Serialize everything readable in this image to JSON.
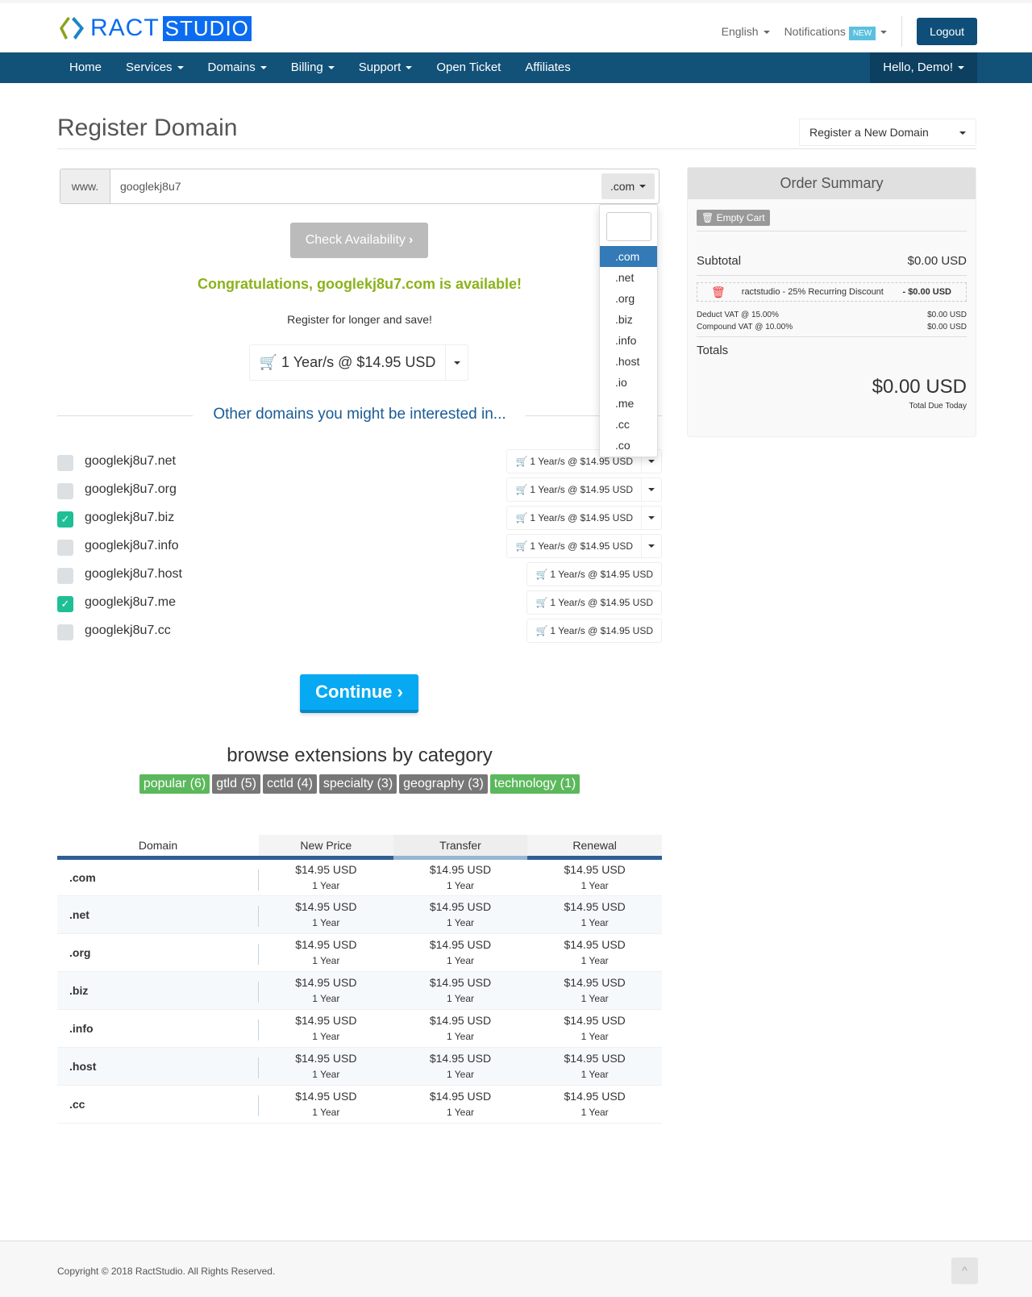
{
  "brand": {
    "logo_text_1": "RACT",
    "logo_text_2": "STUDIO"
  },
  "top": {
    "language": "English",
    "notifications": "Notifications",
    "new_badge": "NEW",
    "logout": "Logout"
  },
  "nav": {
    "items": [
      "Home",
      "Services",
      "Domains",
      "Billing",
      "Support",
      "Open Ticket",
      "Affiliates"
    ],
    "user": "Hello, Demo!"
  },
  "page": {
    "title": "Register Domain",
    "action_select": "Register a New Domain"
  },
  "search": {
    "prefix": "www.",
    "value": "googlekj8u7",
    "tld": ".com",
    "tld_options": [
      ".com",
      ".net",
      ".org",
      ".biz",
      ".info",
      ".host",
      ".io",
      ".me",
      ".cc",
      ".co"
    ],
    "check_label": "Check Availability"
  },
  "result": {
    "message": "Congratulations, googlekj8u7.com is available!",
    "longer": "Register for longer and save!",
    "price": "1 Year/s @ $14.95 USD"
  },
  "suggestions": {
    "heading": "Other domains you might be interested in...",
    "items": [
      {
        "domain": "googlekj8u7.net",
        "checked": false,
        "price": "1 Year/s @ $14.95 USD"
      },
      {
        "domain": "googlekj8u7.org",
        "checked": false,
        "price": "1 Year/s @ $14.95 USD"
      },
      {
        "domain": "googlekj8u7.biz",
        "checked": true,
        "price": "1 Year/s @ $14.95 USD"
      },
      {
        "domain": "googlekj8u7.info",
        "checked": false,
        "price": "1 Year/s @ $14.95 USD"
      },
      {
        "domain": "googlekj8u7.host",
        "checked": false,
        "price": "1 Year/s @ $14.95 USD"
      },
      {
        "domain": "googlekj8u7.me",
        "checked": true,
        "price": "1 Year/s @ $14.95 USD"
      },
      {
        "domain": "googlekj8u7.cc",
        "checked": false,
        "price": "1 Year/s @ $14.95 USD"
      }
    ]
  },
  "continue_label": "Continue",
  "browse": {
    "heading": "browse extensions by category",
    "tags": [
      "popular (6)",
      "gtld (5)",
      "cctld (4)",
      "specialty (3)",
      "geography (3)",
      "technology (1)"
    ]
  },
  "pricing": {
    "headers": [
      "Domain",
      "New Price",
      "Transfer",
      "Renewal"
    ],
    "rows": [
      {
        "tld": ".com",
        "new": "$14.95 USD",
        "transfer": "$14.95 USD",
        "renewal": "$14.95 USD",
        "period": "1 Year"
      },
      {
        "tld": ".net",
        "new": "$14.95 USD",
        "transfer": "$14.95 USD",
        "renewal": "$14.95 USD",
        "period": "1 Year"
      },
      {
        "tld": ".org",
        "new": "$14.95 USD",
        "transfer": "$14.95 USD",
        "renewal": "$14.95 USD",
        "period": "1 Year"
      },
      {
        "tld": ".biz",
        "new": "$14.95 USD",
        "transfer": "$14.95 USD",
        "renewal": "$14.95 USD",
        "period": "1 Year"
      },
      {
        "tld": ".info",
        "new": "$14.95 USD",
        "transfer": "$14.95 USD",
        "renewal": "$14.95 USD",
        "period": "1 Year"
      },
      {
        "tld": ".host",
        "new": "$14.95 USD",
        "transfer": "$14.95 USD",
        "renewal": "$14.95 USD",
        "period": "1 Year"
      },
      {
        "tld": ".cc",
        "new": "$14.95 USD",
        "transfer": "$14.95 USD",
        "renewal": "$14.95 USD",
        "period": "1 Year"
      }
    ]
  },
  "summary": {
    "title": "Order Summary",
    "empty_cart": "Empty Cart",
    "subtotal_label": "Subtotal",
    "subtotal": "$0.00 USD",
    "discount_label": "ractstudio - 25% Recurring Discount",
    "discount": "- $0.00 USD",
    "vat1_label": "Deduct VAT @ 15.00%",
    "vat1": "$0.00 USD",
    "vat2_label": "Compound VAT @ 10.00%",
    "vat2": "$0.00 USD",
    "totals_label": "Totals",
    "total": "$0.00 USD",
    "total_due": "Total Due Today"
  },
  "footer": {
    "copyright": "Copyright © 2018 RactStudio. All Rights Reserved."
  }
}
